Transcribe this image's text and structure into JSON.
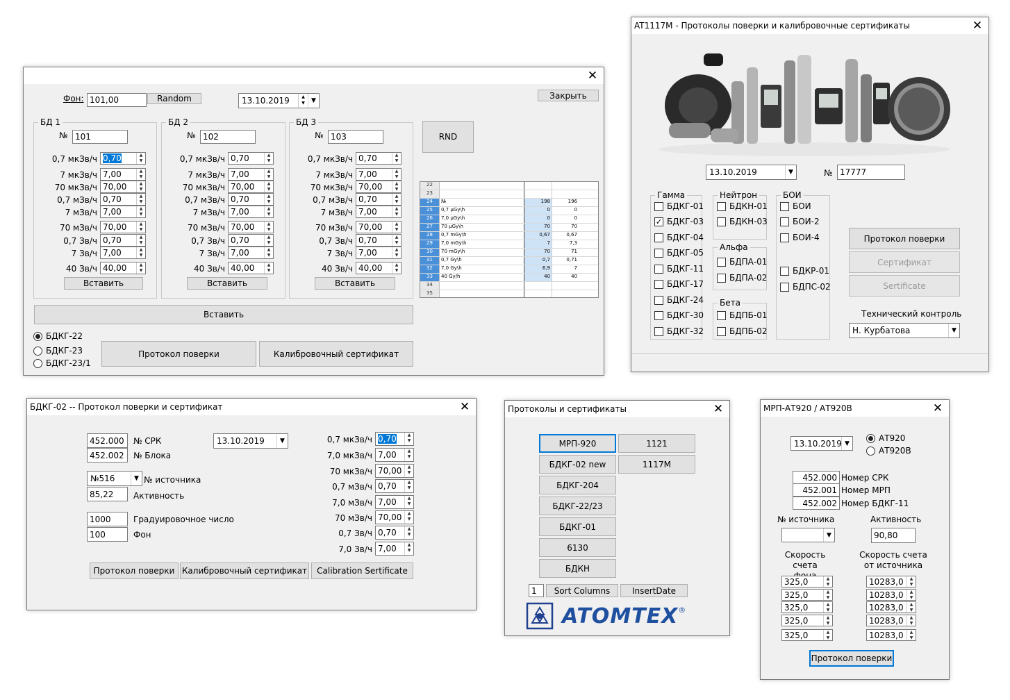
{
  "w1": {
    "fon_label": "Фон:",
    "fon_value": "101,00",
    "random_btn": "Random",
    "date": "13.10.2019",
    "close_btn": "Закрыть",
    "rnd_btn": "RND",
    "groups": [
      {
        "title": "БД 1",
        "num": "101"
      },
      {
        "title": "БД 2",
        "num": "102"
      },
      {
        "title": "БД 3",
        "num": "103"
      }
    ],
    "num_label": "№",
    "rows": [
      {
        "label": "0,7 мкЗв/ч",
        "value": "0,70"
      },
      {
        "label": "7 мкЗв/ч",
        "value": "7,00"
      },
      {
        "label": "70 мкЗв/ч",
        "value": "70,00"
      },
      {
        "label": "0,7 мЗв/ч",
        "value": "0,70"
      },
      {
        "label": "7 мЗв/ч",
        "value": "7,00"
      },
      {
        "label": "70 мЗв/ч",
        "value": "70,00"
      },
      {
        "label": "0,7 Зв/ч",
        "value": "0,70"
      },
      {
        "label": "7 Зв/ч",
        "value": "7,00"
      },
      {
        "label": "40 Зв/ч",
        "value": "40,00"
      }
    ],
    "insert_btn": "Вставить",
    "insert_all_btn": "Вставить",
    "radios": [
      "БДКГ-22",
      "БДКГ-23",
      "БДКГ-23/1"
    ],
    "protocol_btn": "Протокол поверки",
    "calib_btn": "Калибровочный сертификат",
    "sheet": {
      "rows": [
        {
          "n": "22",
          "a": "",
          "b": "",
          "c": ""
        },
        {
          "n": "23",
          "a": "",
          "b": "",
          "c": ""
        },
        {
          "n": "24",
          "a": "№",
          "b": "198",
          "c": "196"
        },
        {
          "n": "25",
          "a": "0,7  µGy\\h",
          "b": "0",
          "c": "0"
        },
        {
          "n": "26",
          "a": "7,0  µGy\\h",
          "b": "0",
          "c": "0"
        },
        {
          "n": "27",
          "a": "70 µGy\\h",
          "b": "70",
          "c": "70"
        },
        {
          "n": "28",
          "a": "0,7 mGy\\h",
          "b": "0,67",
          "c": "0,67"
        },
        {
          "n": "29",
          "a": "7,0 mGy\\h",
          "b": "7",
          "c": "7,3"
        },
        {
          "n": "30",
          "a": "70  mGy\\h",
          "b": "70",
          "c": "71"
        },
        {
          "n": "31",
          "a": "0,7 Gy\\h",
          "b": "0,7",
          "c": "0,71"
        },
        {
          "n": "32",
          "a": "7,0  Gy\\h",
          "b": "6,9",
          "c": "7"
        },
        {
          "n": "33",
          "a": "40 Gy/h",
          "b": "40",
          "c": "40"
        },
        {
          "n": "34",
          "a": "",
          "b": "",
          "c": ""
        },
        {
          "n": "35",
          "a": "",
          "b": "",
          "c": ""
        }
      ]
    }
  },
  "w2": {
    "title": "AT1117M - Протоколы поверки и калибровочные сертификаты",
    "date": "13.10.2019",
    "num_label": "№",
    "num_value": "17777",
    "gamma_title": "Гамма",
    "gamma": [
      {
        "label": "БДКГ-01",
        "checked": false
      },
      {
        "label": "БДКГ-03",
        "checked": true
      },
      {
        "label": "БДКГ-04",
        "checked": false
      },
      {
        "label": "БДКГ-05",
        "checked": false
      },
      {
        "label": "БДКГ-11",
        "checked": false
      },
      {
        "label": "БДКГ-17",
        "checked": false
      },
      {
        "label": "БДКГ-24",
        "checked": false
      },
      {
        "label": "БДКГ-30",
        "checked": false
      },
      {
        "label": "БДКГ-32",
        "checked": false
      }
    ],
    "neutron_title": "Нейтрон",
    "neutron": [
      "БДКН-01",
      "БДКН-03"
    ],
    "alpha_title": "Альфа",
    "alpha": [
      "БДПА-01",
      "БДПА-02"
    ],
    "beta_title": "Бета",
    "beta": [
      "БДПБ-01",
      "БДПБ-02"
    ],
    "boi_title": "БОИ",
    "boi": [
      "БОИ",
      "БОИ-2",
      "БОИ-4",
      "БДКР-01",
      "БДПС-02"
    ],
    "protocol_btn": "Протокол поверки",
    "cert_btn": "Сертификат",
    "cert_en_btn": "Sertificate",
    "tech_label": "Технический контроль",
    "tech_value": "Н. Курбатова"
  },
  "w3": {
    "title": "БДКГ-02 -- Протокол поверки и сертификат",
    "srk_value": "452.000",
    "srk_label": "№ СРК",
    "block_value": "452.002",
    "block_label": "№ Блока",
    "date": "13.10.2019",
    "source_value": "№516",
    "source_label": "№ источника",
    "activity_value": "85,22",
    "activity_label": "Активность",
    "grad_value": "1000",
    "grad_label": "Градуировочное число",
    "fon_value": "100",
    "fon_label": "Фон",
    "rows": [
      {
        "label": "0,7 мкЗв/ч",
        "value": "0,70"
      },
      {
        "label": "7,0 мкЗв/ч",
        "value": "7,00"
      },
      {
        "label": "70 мкЗв/ч",
        "value": "70,00"
      },
      {
        "label": "0,7 мЗв/ч",
        "value": "0,70"
      },
      {
        "label": "7,0 мЗв/ч",
        "value": "7,00"
      },
      {
        "label": "70 мЗв/ч",
        "value": "70,00"
      },
      {
        "label": "0,7 Зв/ч",
        "value": "0,70"
      },
      {
        "label": "7,0 Зв/ч",
        "value": "7,00"
      }
    ],
    "protocol_btn": "Протокол поверки",
    "calib_btn": "Калибровочный сертификат",
    "calib_en_btn": "Calibration Sertificate"
  },
  "w4": {
    "title": "Протоколы и сертификаты",
    "buttons_left": [
      "МРП-920",
      "БДКГ-02 new",
      "БДКГ-204",
      "БДКГ-22/23",
      "БДКГ-01",
      "6130",
      "БДКН"
    ],
    "buttons_right": [
      "1121",
      "1117M"
    ],
    "num_value": "1",
    "sort_btn": "Sort Columns",
    "insert_date_btn": "InsertDate",
    "logo_text": "ATOMTEX",
    "logo_reg": "®"
  },
  "w5": {
    "title": "МРП-АТ920 / АТ920В",
    "date": "13.10.2019",
    "radios": [
      "АТ920",
      "АТ920В"
    ],
    "srk_value": "452.000",
    "srk_label": "Номер СРК",
    "mrp_value": "452.001",
    "mrp_label": "Номер МРП",
    "bdkg_value": "452.002",
    "bdkg_label": "Номер БДКГ-11",
    "source_label": "№ источника",
    "activity_label": "Активность",
    "activity_value": "90,80",
    "fon_speed_label": "Скорость счета фона",
    "src_speed_label": "Скорость счета от источника",
    "fon_values": [
      "325,0",
      "325,0",
      "325,0",
      "325,0",
      "325,0"
    ],
    "src_values": [
      "10283,0",
      "10283,0",
      "10283,0",
      "10283,0",
      "10283,0"
    ],
    "protocol_btn": "Протокол поверки"
  }
}
